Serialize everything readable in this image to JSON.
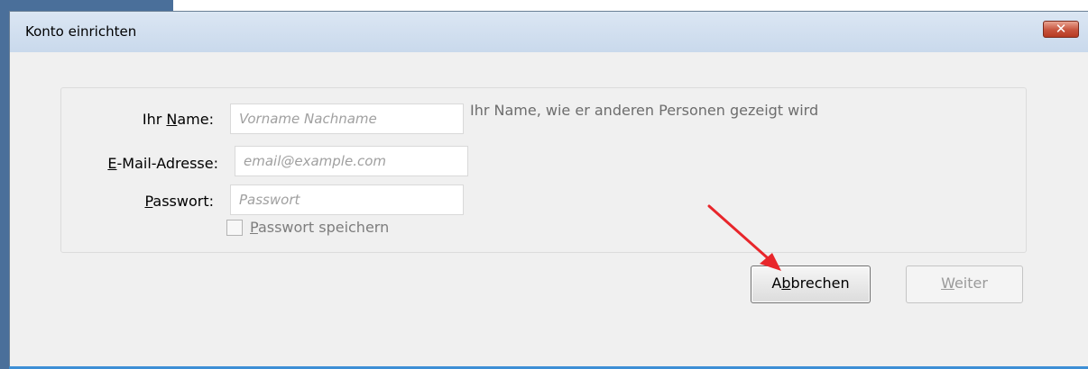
{
  "dialog": {
    "title": "Konto einrichten",
    "close_symbol": "✕"
  },
  "form": {
    "name": {
      "label_prefix": "Ihr ",
      "label_accesskey": "N",
      "label_rest": "ame:",
      "placeholder": "Vorname Nachname",
      "value": "",
      "hint": "Ihr Name, wie er anderen Personen gezeigt wird"
    },
    "email": {
      "label_accesskey": "E",
      "label_rest": "-Mail-Adresse:",
      "placeholder": "email@example.com",
      "value": ""
    },
    "password": {
      "label_accesskey": "P",
      "label_rest": "asswort:",
      "placeholder": "Passwort",
      "value": ""
    },
    "remember": {
      "label_accesskey": "P",
      "label_rest": "asswort speichern",
      "checked": false
    }
  },
  "buttons": {
    "cancel": {
      "pre": "A",
      "accesskey": "b",
      "post": "brechen"
    },
    "next": {
      "pre": "",
      "accesskey": "W",
      "post": "eiter",
      "enabled": false
    }
  },
  "annotation": {
    "arrow_color": "#e8262b"
  }
}
